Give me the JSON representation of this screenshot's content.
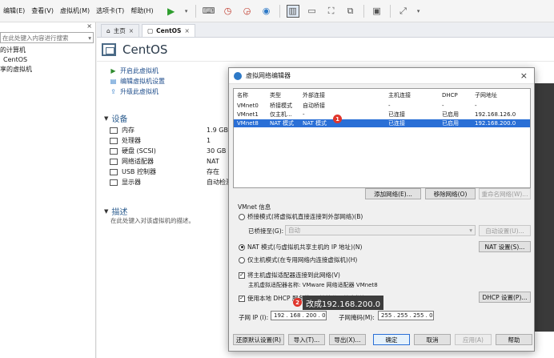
{
  "menubar": {
    "items": [
      "编辑(E)",
      "查看(V)",
      "虚拟机(M)",
      "选项卡(T)",
      "帮助(H)"
    ]
  },
  "library": {
    "close": "×",
    "search_placeholder": "在此处键入内容进行搜索",
    "tree": [
      "的计算机",
      "CentOS",
      "享的虚拟机"
    ]
  },
  "tabs": [
    {
      "label": "主页",
      "close": "×"
    },
    {
      "label": "CentOS",
      "close": "×"
    }
  ],
  "vm": {
    "title": "CentOS",
    "actions": [
      "开启此虚拟机",
      "编辑虚拟机设置",
      "升级此虚拟机"
    ],
    "devices_title": "设备",
    "devices": [
      {
        "name": "内存",
        "value": "1.9 GB"
      },
      {
        "name": "处理器",
        "value": "1"
      },
      {
        "name": "硬盘 (SCSI)",
        "value": "30 GB"
      },
      {
        "name": "网络适配器",
        "value": "NAT"
      },
      {
        "name": "USB 控制器",
        "value": "存在"
      },
      {
        "name": "显示器",
        "value": "自动检测"
      }
    ],
    "description_title": "描述",
    "description_text": "在此处键入对该虚拟机的描述。"
  },
  "dialog": {
    "title": "虚拟网络编辑器",
    "close": "×",
    "table": {
      "headers": [
        "名称",
        "类型",
        "外部连接",
        "主机连接",
        "DHCP",
        "子网地址"
      ],
      "rows": [
        [
          "VMnet0",
          "桥接模式",
          "自动桥接",
          "-",
          "-",
          "-"
        ],
        [
          "VMnet1",
          "仅主机...",
          "-",
          "已连接",
          "已启用",
          "192.168.126.0"
        ],
        [
          "VMnet8",
          "NAT 模式",
          "NAT 模式",
          "已连接",
          "已启用",
          "192.168.200.0"
        ]
      ],
      "selected_row": 2
    },
    "buttons": {
      "add_network": "添加网络(E)...",
      "remove_network": "移除网络(O)",
      "rename_network": "重命名网络(W)...",
      "auto_settings": "自动设置(U)...",
      "nat_settings": "NAT 设置(S)...",
      "dhcp_settings": "DHCP 设置(P)...",
      "restore_defaults": "还原默认设置(R)",
      "import": "导入(T)...",
      "export": "导出(X)...",
      "ok": "确定",
      "cancel": "取消",
      "apply": "应用(A)",
      "help": "帮助"
    },
    "vmnet_info_label": "VMnet 信息",
    "bridged_mode": "桥接模式(将虚拟机直接连接到外部网络)(B)",
    "bridged_to_label": "已桥接至(G):",
    "bridged_to_value": "自动",
    "nat_mode": "NAT 模式(与虚拟机共享主机的 IP 地址)(N)",
    "host_only_mode": "仅主机模式(在专用网络内连接虚拟机)(H)",
    "connect_adapter": "将主机虚拟适配器连接到此网络(V)",
    "adapter_name": "主机虚拟适配器名称: VMware 网络适配器 VMnet8",
    "use_dhcp": "使用本地 DHCP 服务将 IP 地址分配给虚拟机(D)",
    "subnet_ip_label": "子网 IP (I):",
    "subnet_ip": "192 . 168 . 200 . 0",
    "subnet_mask_label": "子网掩码(M):",
    "subnet_mask": "255 . 255 . 255 . 0"
  },
  "annotations": {
    "badge1": "1",
    "badge2": "2",
    "tooltip": "改成192.168.200.0"
  }
}
